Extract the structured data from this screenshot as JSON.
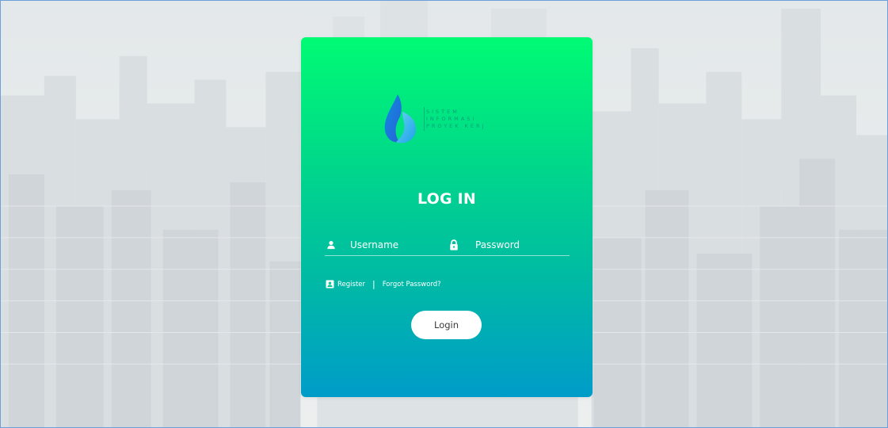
{
  "background": {
    "description_icon": "city-skyline-background"
  },
  "colors": {
    "card_top": "#00fb74",
    "card_bottom": "#009cc9",
    "button_bg": "#ffffff",
    "button_text": "#3a3a3a",
    "frame_border": "#6f9fd8"
  },
  "logo": {
    "icon": "flame-drop-logo-icon",
    "lines": [
      "SISTEM",
      "INFORMASI",
      "PROYEK KERJ"
    ]
  },
  "form": {
    "title": "LOG IN",
    "username": {
      "icon": "user-icon",
      "placeholder": "Username",
      "value": ""
    },
    "password": {
      "icon": "lock-icon",
      "placeholder": "Password",
      "value": ""
    },
    "links": {
      "register_icon": "contact-card-icon",
      "register_label": "Register",
      "separator": "|",
      "forgot_label": "Forgot Password?"
    },
    "login_button": "Login"
  }
}
